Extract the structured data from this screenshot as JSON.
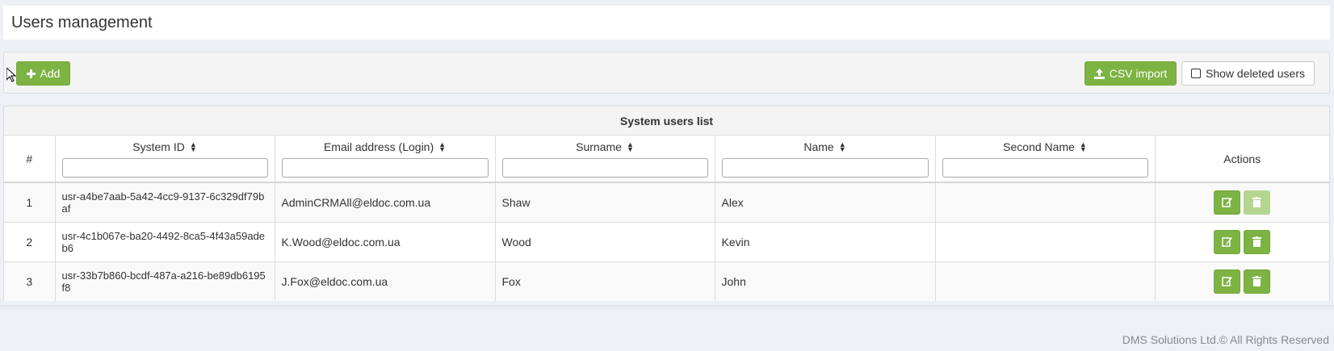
{
  "page": {
    "title": "Users management"
  },
  "toolbar": {
    "add_label": "Add",
    "csv_import_label": "CSV import",
    "show_deleted_label": "Show deleted users",
    "show_deleted_checked": false
  },
  "table": {
    "caption": "System users list",
    "columns": {
      "num": "#",
      "system_id": "System ID",
      "email": "Email address (Login)",
      "surname": "Surname",
      "name": "Name",
      "second_name": "Second Name",
      "actions": "Actions"
    },
    "rows": [
      {
        "num": "1",
        "system_id": "usr-a4be7aab-5a42-4cc9-9137-6c329df79baf",
        "email": "AdminCRMAll@eldoc.com.ua",
        "surname": "Shaw",
        "name": "Alex",
        "second_name": "",
        "delete_disabled": true
      },
      {
        "num": "2",
        "system_id": "usr-4c1b067e-ba20-4492-8ca5-4f43a59adeb6",
        "email": "K.Wood@eldoc.com.ua",
        "surname": "Wood",
        "name": "Kevin",
        "second_name": "",
        "delete_disabled": false
      },
      {
        "num": "3",
        "system_id": "usr-33b7b860-bcdf-487a-a216-be89db6195f8",
        "email": "J.Fox@eldoc.com.ua",
        "surname": "Fox",
        "name": "John",
        "second_name": "",
        "delete_disabled": false
      }
    ]
  },
  "footer": {
    "text": "DMS Solutions Ltd.© All Rights Reserved"
  },
  "colors": {
    "accent_green": "#7cb342",
    "disabled_green": "#b5d68f",
    "background": "#edf1f5"
  },
  "icons": {
    "add": "plus-icon",
    "csv": "upload-icon",
    "edit": "edit-icon",
    "delete": "trash-icon",
    "sort": "sort-icon"
  }
}
